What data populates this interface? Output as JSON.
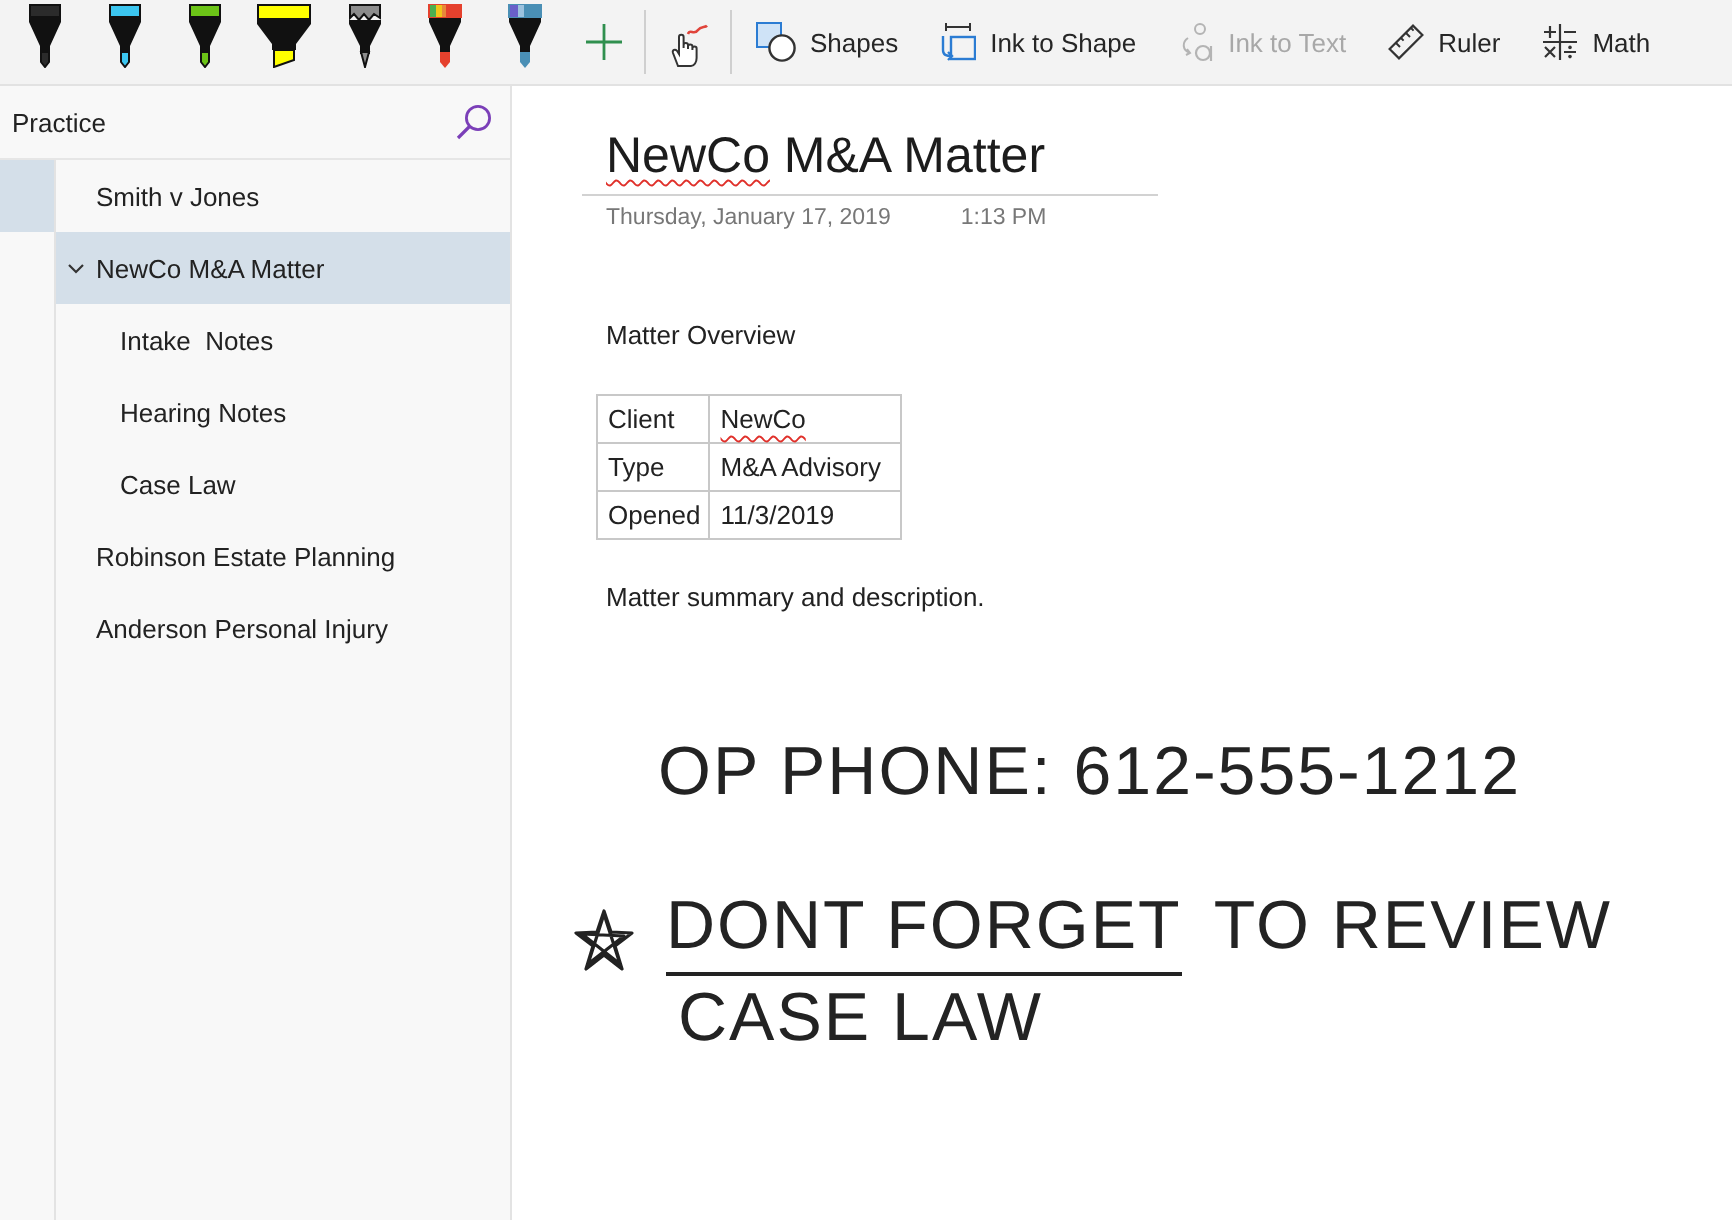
{
  "toolbar": {
    "pens": [
      {
        "kind": "pen",
        "color": "#2b2b2b"
      },
      {
        "kind": "pen",
        "color": "#3cc6f0"
      },
      {
        "kind": "pen",
        "color": "#6cc417"
      },
      {
        "kind": "highlighter",
        "color": "#ffff00"
      },
      {
        "kind": "pencil",
        "color": "#8c8c8c"
      },
      {
        "kind": "rainbow",
        "color": "#e5412d"
      },
      {
        "kind": "galaxy",
        "color": "#4a8fb5"
      }
    ],
    "buttons": [
      {
        "label": "Shapes",
        "disabled": false
      },
      {
        "label": "Ink to Shape",
        "disabled": false
      },
      {
        "label": "Ink to Text",
        "disabled": true
      },
      {
        "label": "Ruler",
        "disabled": false
      },
      {
        "label": "Math",
        "disabled": false
      }
    ]
  },
  "sidebar": {
    "title": "Practice",
    "sections": [
      {
        "selected": true
      }
    ],
    "pages": [
      {
        "title": "Smith v Jones",
        "selected": false
      },
      {
        "title": "NewCo M&A Matter",
        "selected": true,
        "expanded": true,
        "children": [
          {
            "title": "Intake  Notes",
            "selected": false
          },
          {
            "title": "Hearing Notes",
            "selected": false
          },
          {
            "title": "Case Law",
            "selected": false
          }
        ]
      },
      {
        "title": "Robinson Estate Planning",
        "selected": false
      },
      {
        "title": "Anderson Personal Injury",
        "selected": false
      }
    ]
  },
  "page": {
    "title": {
      "text": "NewCo M&A Matter",
      "first_word_misspelled": true
    },
    "date": "Thursday, January 17, 2019",
    "time": "1:13 PM",
    "heading": "Matter Overview",
    "table": {
      "rows": [
        {
          "label": "Client",
          "value": "NewCo",
          "misspelled": true
        },
        {
          "label": "Type",
          "value": "M&A Advisory",
          "misspelled": false
        },
        {
          "label": "Opened",
          "value": "11/3/2019",
          "misspelled": false
        }
      ]
    },
    "summary": "Matter summary and description.",
    "ink": [
      {
        "starred": false,
        "parts": [
          {
            "text": "OP PHONE: 612-555-1212",
            "underlined": false
          }
        ]
      },
      {
        "starred": true,
        "parts": [
          {
            "text": "DONT FORGET",
            "underlined": true
          },
          {
            "text": "TO REVIEW",
            "underlined": false
          }
        ]
      },
      {
        "starred": false,
        "parts": [
          {
            "text": "CASE LAW",
            "underlined": false
          }
        ]
      }
    ]
  }
}
